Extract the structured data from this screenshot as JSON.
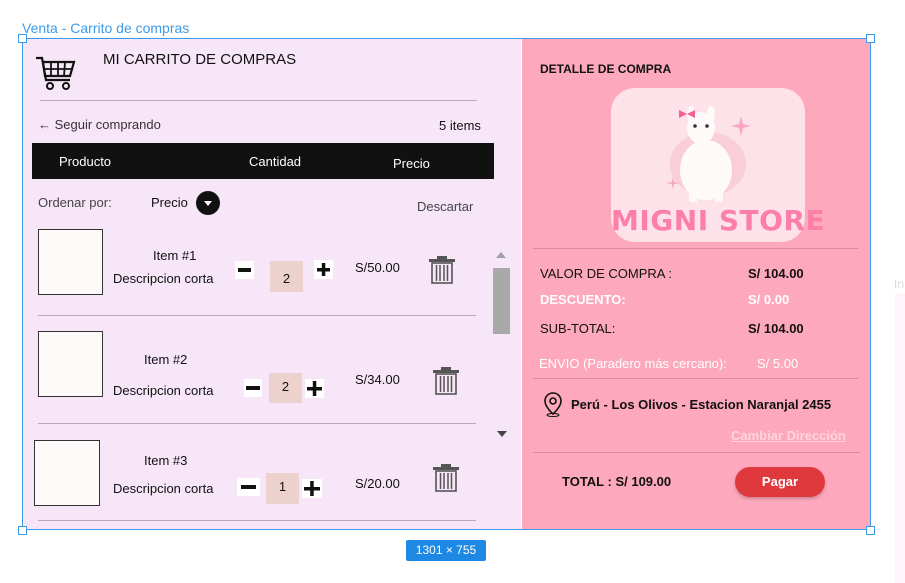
{
  "frame": {
    "label": "Venta - Carrito de compras",
    "dimensions": "1301 × 755",
    "edge_label": "In"
  },
  "cart": {
    "title": "MI CARRITO DE COMPRAS",
    "back_link": "← Seguir comprando",
    "items_count": "5 items",
    "columns": [
      "Producto",
      "Cantidad",
      "Precio"
    ],
    "sort_label": "Ordenar por:",
    "sort_value": "Precio",
    "discard_label": "Descartar",
    "items": [
      {
        "name": "Item #1",
        "description": "Descripcion corta",
        "quantity": "2",
        "price": "S/50.00"
      },
      {
        "name": "Item #2",
        "description": "Descripcion corta",
        "quantity": "2",
        "price": "S/34.00"
      },
      {
        "name": "Item #3",
        "description": "Descripcion corta",
        "quantity": "1",
        "price": "S/20.00"
      }
    ]
  },
  "summary": {
    "heading": "DETALLE DE COMPRA",
    "store_name": "MIGNI STORE",
    "purchase_value_label": "VALOR DE COMPRA :",
    "purchase_value": "S/ 104.00",
    "discount_label": "DESCUENTO:",
    "discount_value": "S/ 0.00",
    "subtotal_label": "SUB-TOTAL:",
    "subtotal_value": "S/ 104.00",
    "shipping_label": "ENVIO (Paradero más cercano):",
    "shipping_value": "S/ 5.00",
    "address": "Perú - Los Olivos - Estacion Naranjal 2455",
    "change_address": "Cambiar Dirección",
    "total": "TOTAL : S/ 109.00",
    "pay_button": "Pagar"
  },
  "colors": {
    "left_panel": "#f6e6f7",
    "right_panel": "#fda8bc",
    "table_header": "#111111",
    "quantity_box": "#ecd1cd",
    "pay_button": "#e0393d",
    "selection": "#3b9be8"
  },
  "icons": [
    "shopping-cart-icon",
    "arrow-left-icon",
    "chevron-down-icon",
    "minus-icon",
    "plus-icon",
    "trash-icon",
    "location-pin-icon",
    "llama-mascot-icon"
  ]
}
